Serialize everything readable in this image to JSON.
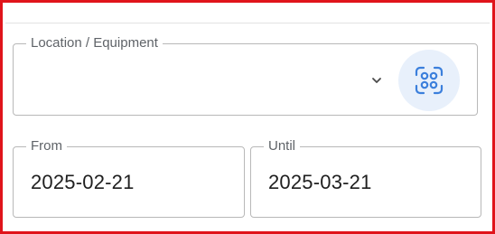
{
  "location": {
    "label": "Location / Equipment",
    "value": "",
    "dropdown_icon": "chevron-down-icon",
    "scan_button_icon": "scan-icon"
  },
  "date_range": {
    "from": {
      "label": "From",
      "value": "2025-02-21"
    },
    "until": {
      "label": "Until",
      "value": "2025-03-21"
    }
  },
  "colors": {
    "frame_border": "#e0141b",
    "field_border": "#b8b8b8",
    "label_text": "#5f6368",
    "value_text": "#1f1f1f",
    "scan_button_bg": "#e8f0fb",
    "scan_icon": "#3b7fdc"
  }
}
